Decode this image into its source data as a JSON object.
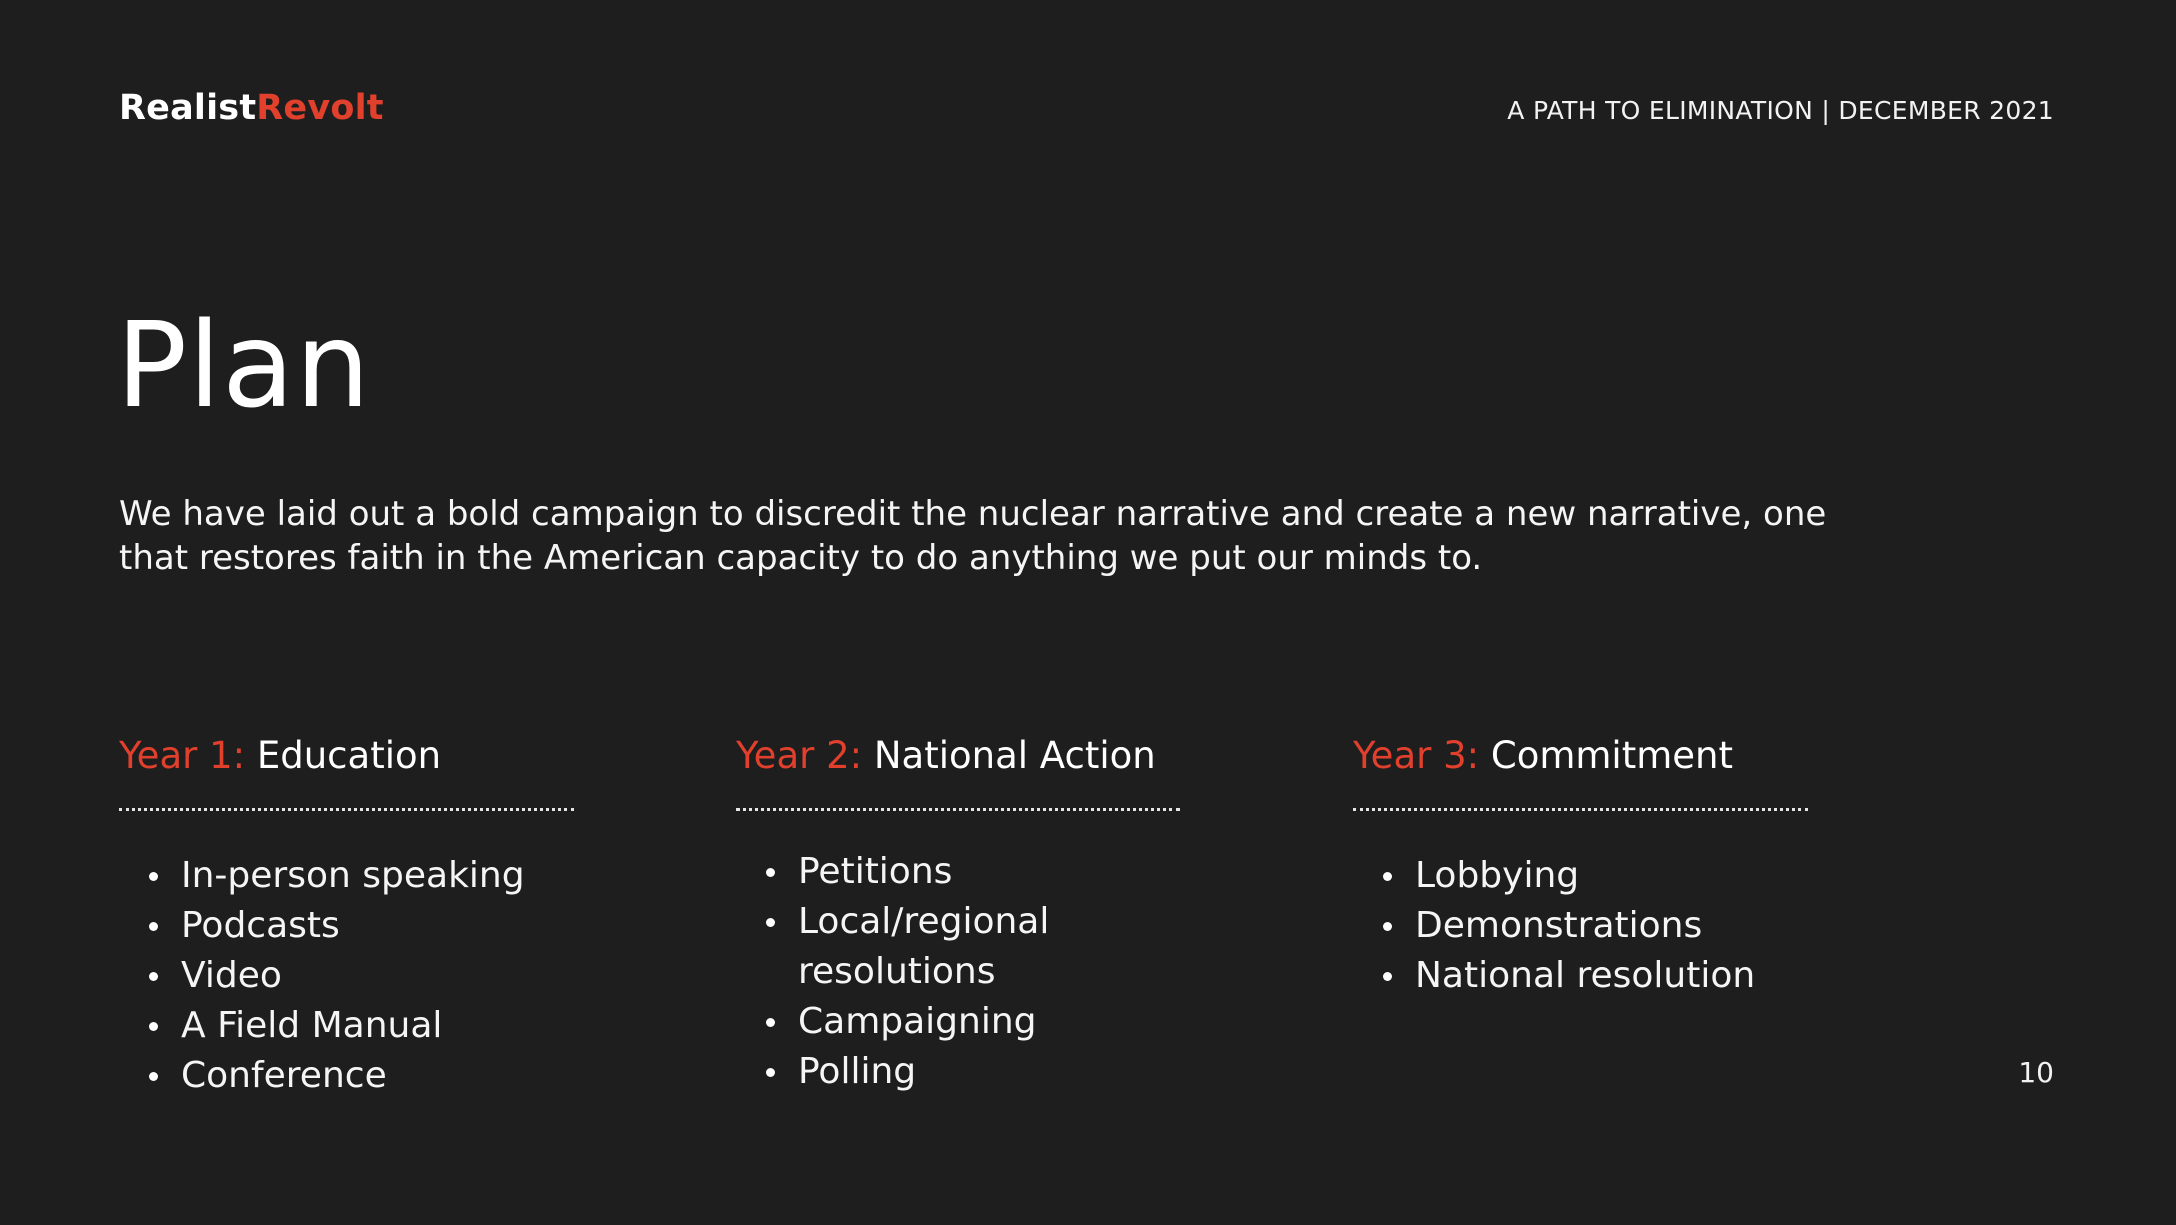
{
  "header": {
    "logo_part1": "Realist",
    "logo_part2": "Revolt",
    "subtitle": "A PATH TO ELIMINATION | DECEMBER 2021"
  },
  "slide": {
    "title": "Plan",
    "intro_line1": "We have laid out a bold campaign to discredit the nuclear narrative and create a new narrative, one",
    "intro_line2": "that  restores faith in the American capacity to do anything we put our minds to."
  },
  "columns": [
    {
      "year": "Year 1:",
      "label": " Education",
      "items": [
        "In-person speaking",
        "Podcasts",
        "Video",
        "A Field Manual",
        "Conference"
      ]
    },
    {
      "year": "Year 2:",
      "label": " National Action",
      "items": [
        "Petitions",
        "Local/regional resolutions",
        "Campaigning",
        "Polling"
      ]
    },
    {
      "year": "Year 3:",
      "label": " Commitment",
      "items": [
        "Lobbying",
        "Demonstrations",
        "National resolution"
      ]
    }
  ],
  "footer": {
    "page_number": "10"
  },
  "colors": {
    "background": "#1e1e1f",
    "accent": "#e0402c",
    "text": "#ffffff"
  }
}
